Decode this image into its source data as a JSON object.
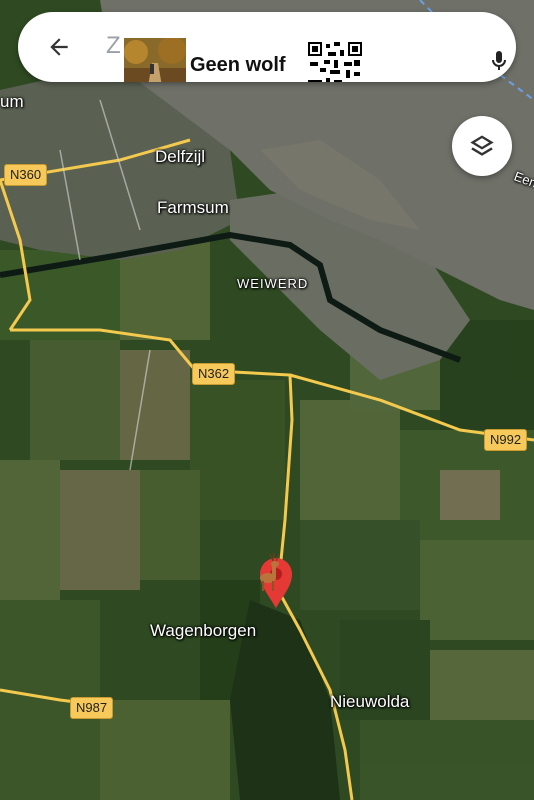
{
  "search": {
    "partial_text": "Z",
    "title": "Geen wolf"
  },
  "icons": {
    "back": "arrow-left-icon",
    "mic": "microphone-icon",
    "layers": "layers-icon",
    "marker": "deer-pin-marker-icon"
  },
  "places": {
    "partial_left": "um",
    "delfzijl": "Delfzijl",
    "farmsum": "Farmsum",
    "weiwerd": "WEIWERD",
    "wagenborgen": "Wagenborgen",
    "nieuwolda": "Nieuwolda",
    "water_partial": "Een"
  },
  "roads": {
    "n360": "N360",
    "n362": "N362",
    "n992": "N992",
    "n987": "N987"
  },
  "colors": {
    "water": "#6f7068",
    "farmland": "#2f4f24",
    "road": "#f3c94e",
    "marker": "#e53935"
  }
}
